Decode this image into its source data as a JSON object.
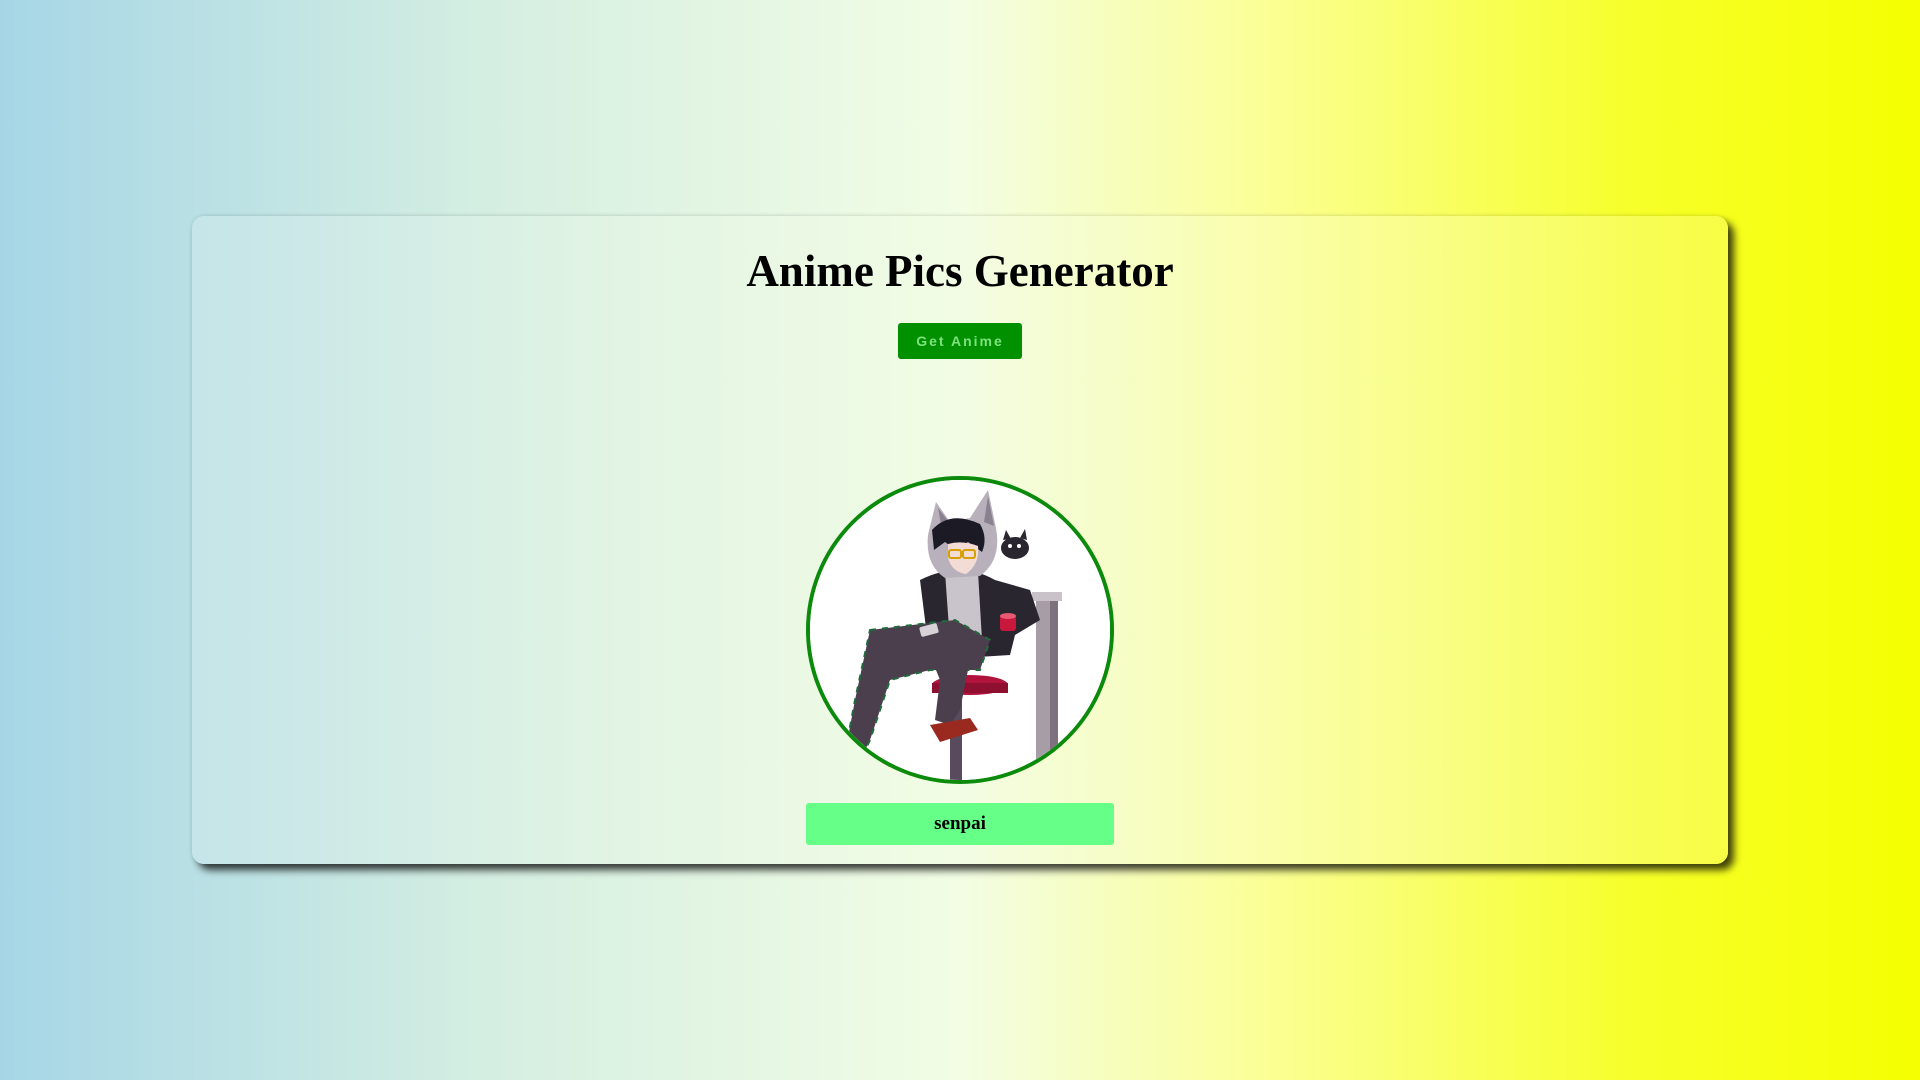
{
  "header": {
    "title": "Anime Pics Generator"
  },
  "actions": {
    "get_button_label": "Get Anime"
  },
  "result": {
    "character_name": "senpai",
    "image_description": "anime character in grey cat-ear hoodie sitting on a stool with a phone, small cat on shoulder"
  },
  "colors": {
    "button_bg": "#009000",
    "avatar_border": "#0c8a0c",
    "name_bar_bg": "#66ff88",
    "gradient_left": "#a6d6e6",
    "gradient_right": "#f5ff00"
  }
}
